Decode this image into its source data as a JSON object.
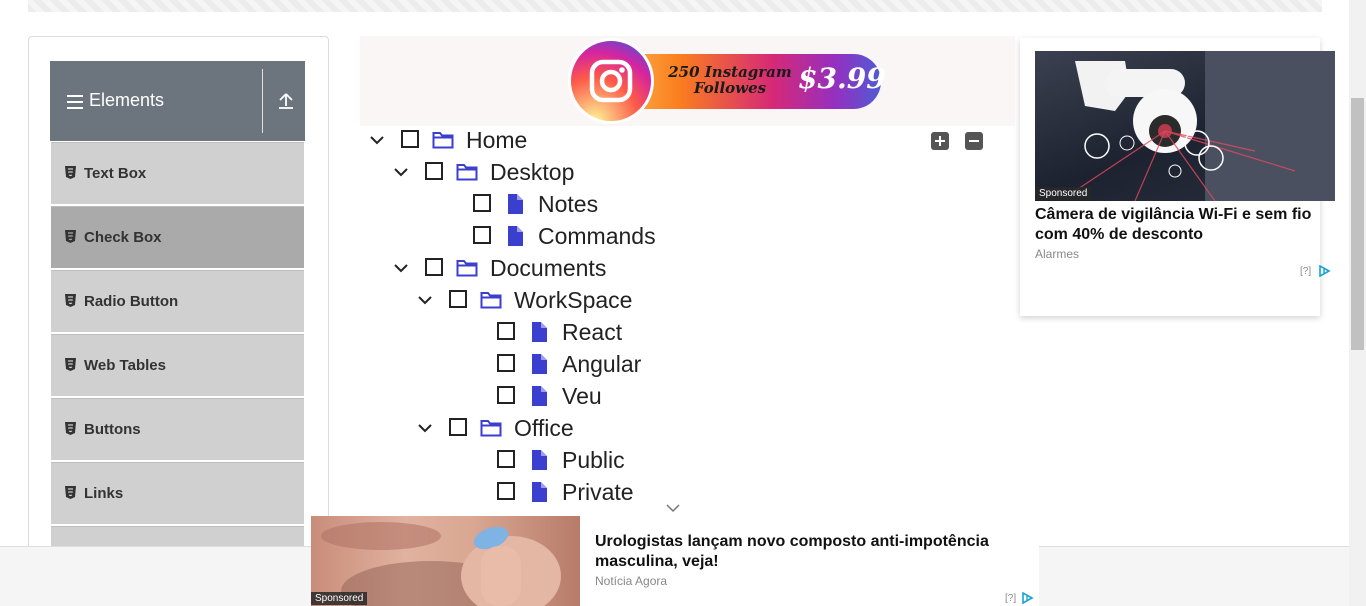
{
  "sidebar": {
    "group_title": "Elements",
    "items": [
      {
        "label": "Text Box"
      },
      {
        "label": "Check Box"
      },
      {
        "label": "Radio Button"
      },
      {
        "label": "Web Tables"
      },
      {
        "label": "Buttons"
      },
      {
        "label": "Links"
      }
    ],
    "active_item": "Check Box"
  },
  "top_ad": {
    "text": "250 Instagram Followes",
    "price": "$3.99"
  },
  "tree": {
    "nodes": [
      {
        "label": "Home",
        "type": "folder",
        "expanded": true,
        "checked": false
      },
      {
        "label": "Desktop",
        "type": "folder",
        "expanded": true,
        "checked": false
      },
      {
        "label": "Notes",
        "type": "file",
        "checked": false
      },
      {
        "label": "Commands",
        "type": "file",
        "checked": false
      },
      {
        "label": "Documents",
        "type": "folder",
        "expanded": true,
        "checked": false
      },
      {
        "label": "WorkSpace",
        "type": "folder",
        "expanded": true,
        "checked": false
      },
      {
        "label": "React",
        "type": "file",
        "checked": false
      },
      {
        "label": "Angular",
        "type": "file",
        "checked": false
      },
      {
        "label": "Veu",
        "type": "file",
        "checked": false
      },
      {
        "label": "Office",
        "type": "folder",
        "expanded": true,
        "checked": false
      },
      {
        "label": "Public",
        "type": "file",
        "checked": false
      },
      {
        "label": "Private",
        "type": "file",
        "checked": false
      }
    ],
    "expand_all_icon": "plus-square-icon",
    "collapse_all_icon": "minus-square-icon"
  },
  "right_ad": {
    "sponsored": "Sponsored",
    "title": "Câmera de vigilância Wi-Fi e sem fio com 40% de desconto",
    "source": "Alarmes",
    "info": "[?]"
  },
  "bottom_ad": {
    "sponsored": "Sponsored",
    "title": "Urologistas lançam novo composto anti-impotência masculina, veja!",
    "source": "Notícia Agora",
    "info": "[?]"
  },
  "colors": {
    "sidebar_header": "#6c757d",
    "menu_item": "#d0d0d0",
    "menu_item_active": "#aaaaaa",
    "tree_icon": "#3a3fd0"
  }
}
